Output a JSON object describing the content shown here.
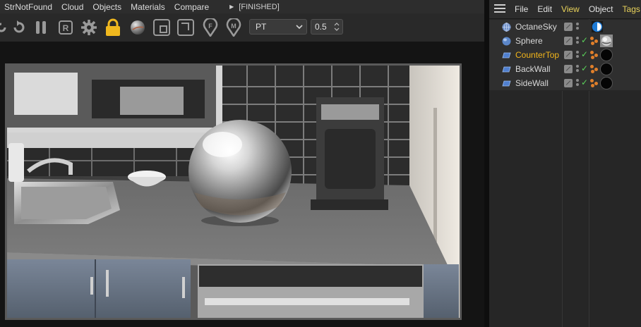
{
  "left_menu": [
    "StrNotFound",
    "Cloud",
    "Objects",
    "Materials",
    "Compare"
  ],
  "status_text": "[FINISHED]",
  "toolbar": {
    "icons": [
      "undo-icon",
      "redo-icon",
      "pause-icon",
      "region-render-icon",
      "settings-gear-icon",
      "lock-icon",
      "material-sphere-icon",
      "crop-region-icon",
      "film-region-icon",
      "focus-pick-icon",
      "material-pick-icon"
    ],
    "mode": "PT",
    "value": "0.5"
  },
  "object_manager": {
    "menu": [
      "File",
      "Edit",
      "View",
      "Object",
      "Tags"
    ],
    "active_menu": "View",
    "objects": [
      {
        "name": "OctaneSky",
        "icon": "sky-icon",
        "selected": false,
        "tag": "octane-sky-tag-icon"
      },
      {
        "name": "Sphere",
        "icon": "sphere-icon",
        "selected": false,
        "tag": "mirror-material-tag-icon"
      },
      {
        "name": "CounterTop",
        "icon": "plane-icon",
        "selected": true,
        "tag": "black-material-tag-icon"
      },
      {
        "name": "BackWall",
        "icon": "plane-icon",
        "selected": false,
        "tag": "black-material-tag-icon"
      },
      {
        "name": "SideWall",
        "icon": "plane-icon",
        "selected": false,
        "tag": "black-material-tag-icon"
      }
    ]
  }
}
